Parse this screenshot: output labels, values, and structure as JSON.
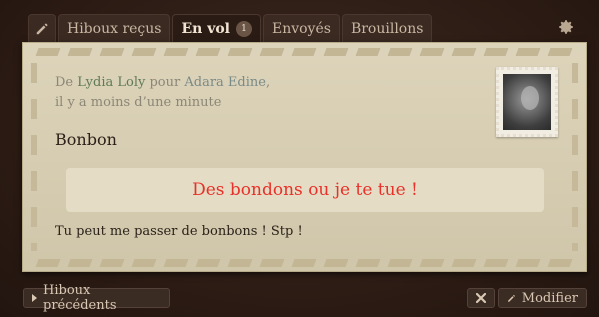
{
  "tabs": [
    {
      "label": "Hiboux reçus"
    },
    {
      "label": "En vol",
      "badge": "1"
    },
    {
      "label": "Envoyés"
    },
    {
      "label": "Brouillons"
    }
  ],
  "message": {
    "from_prefix": "De",
    "sender": "Lydia Loly",
    "to_prefix": "pour",
    "recipient": "Adara Edine",
    "comma": ",",
    "time": "il y a moins d’une minute",
    "subject": "Bonbon",
    "quote": "Des bondons ou je te tue !",
    "body": "Tu peut me passer de bonbons ! Stp !"
  },
  "buttons": {
    "previous": "Hiboux précédents",
    "edit": "Modifier"
  },
  "colors": {
    "accent_red": "#e8312a",
    "name_green": "#5f7b55"
  }
}
